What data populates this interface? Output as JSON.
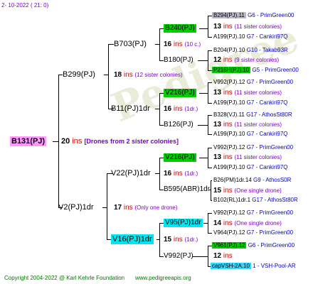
{
  "header": {
    "date": "2- 10-2022",
    "time": "( 21:  0)"
  },
  "root": {
    "name": "B131(PJ)",
    "inbreed": "20",
    "ins": "ins",
    "note": "[Drones from 2 sister colonies]"
  },
  "gen1": [
    {
      "name": "B299(PJ)",
      "count": "18",
      "ins": "ins",
      "note": "(12 sister colonies)"
    },
    {
      "name": "V2(PJ)1dr",
      "count": "17",
      "ins": "ins",
      "note": "(Only one drone)"
    }
  ],
  "gen2": [
    {
      "name": "B703(PJ)",
      "count": "16",
      "ins": "ins",
      "note": "(10 c.)"
    },
    {
      "name": "B11(PJ)1dr",
      "count": "16",
      "ins": "ins",
      "note": "(1dr.)"
    },
    {
      "name": "V22(PJ)1dr",
      "count": "16",
      "ins": "ins",
      "note": "(1dr.)"
    },
    {
      "name": "V16(PJ)1dr",
      "count": "15",
      "ins": "ins",
      "note": "(1dr.)"
    }
  ],
  "gen3": [
    {
      "name": "B240(PJ)"
    },
    {
      "name": "B180(PJ)"
    },
    {
      "name": "V216(PJ)"
    },
    {
      "name": "B126(PJ)"
    },
    {
      "name": "V216(PJ)"
    },
    {
      "name": "B595(ABR)1dr"
    },
    {
      "name": "V95(PJ)1dr"
    },
    {
      "name": "V992(PJ)"
    }
  ],
  "gen4": [
    {
      "name": "B294(PJ).11",
      "breeder": "G6 - PrimGreen00"
    },
    {
      "name": "A199(PJ).10",
      "breeder": "G7 - Cankiri97Q"
    },
    {
      "name": "B204(PJ).10",
      "breeder": "G10 - Takab93R"
    },
    {
      "name": "P216H(PJ).10",
      "breeder": "G5 - PrimGreen00"
    },
    {
      "name": "V992(PJ).12",
      "breeder": "G7 - PrimGreen00"
    },
    {
      "name": "A199(PJ).10",
      "breeder": "G7 - Cankiri97Q"
    },
    {
      "name": "B328(VJ).11",
      "breeder": "G17 - AthosSt80R"
    },
    {
      "name": "A199(PJ).10",
      "breeder": "G7 - Cankiri97Q"
    },
    {
      "name": "V992(PJ).12",
      "breeder": "G7 - PrimGreen00"
    },
    {
      "name": "A199(PJ).10",
      "breeder": "G7 - Cankiri97Q"
    },
    {
      "name": "B26(PM)1dr.14",
      "breeder": "G9 - AthosS0R"
    },
    {
      "name": "B102(RL)1dr.1",
      "breeder": "G17 - AthosSt80R"
    },
    {
      "name": "V992(PJ).12",
      "breeder": "G7 - PrimGreen00"
    },
    {
      "name": "V964(PJ).12",
      "breeder": "G7 - PrimGreen00"
    },
    {
      "name": "V961(PJ).12",
      "breeder": "G6 - PrimGreen00"
    },
    {
      "name": "capVSH-2A.10",
      "breeder": "1 - VSH-Pool-AR"
    }
  ],
  "gen4_pairs": [
    {
      "count": "13",
      "ins": "ins",
      "note": "(11 sister colonies)"
    },
    {
      "count": "12",
      "ins": "ins",
      "note": "(9 sister colonies)"
    },
    {
      "count": "13",
      "ins": "ins",
      "note": "(11 sister colonies)"
    },
    {
      "count": "13",
      "ins": "ins",
      "note": "(11 sister colonies)"
    },
    {
      "count": "13",
      "ins": "ins",
      "note": "(11 sister colonies)"
    },
    {
      "count": "15",
      "ins": "ins",
      "note": "(One single drone)"
    },
    {
      "count": "14",
      "ins": "ins",
      "note": "(One single drone)"
    },
    {
      "count": "12",
      "ins": "ins",
      "note": ""
    }
  ],
  "footer": {
    "copyright": "Copyright 2004-2022 @ Karl Kehrle Foundation",
    "url": "www.pedigreeapis.org"
  },
  "watermark": {
    "text": "Pedigree"
  },
  "colors": {
    "green": "#00cc00",
    "cyan": "#00e6f0",
    "pink": "#ff99ff",
    "gray": "#b8b8c8",
    "ins_red": "#d40000",
    "breeder_blue": "#0000cc",
    "note_purple": "#7a00c8"
  }
}
